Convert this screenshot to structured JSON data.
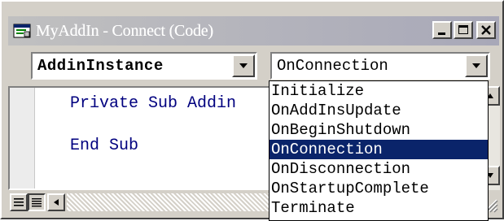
{
  "window": {
    "title": "MyAddIn - Connect (Code)",
    "minimize_glyph": "_",
    "close_glyph": "×"
  },
  "object_combo": {
    "value": "AddinInstance"
  },
  "procedure_combo": {
    "value": "OnConnection",
    "options": [
      "Initialize",
      "OnAddInsUpdate",
      "OnBeginShutdown",
      "OnConnection",
      "OnDisconnection",
      "OnStartupComplete",
      "Terminate"
    ],
    "selected": "OnConnection"
  },
  "code": {
    "line1": "Private Sub Addin",
    "line2": "End Sub"
  },
  "colors": {
    "keyword": "#00007f",
    "selection": "#0a246a",
    "chrome": "#d4d0c8"
  }
}
